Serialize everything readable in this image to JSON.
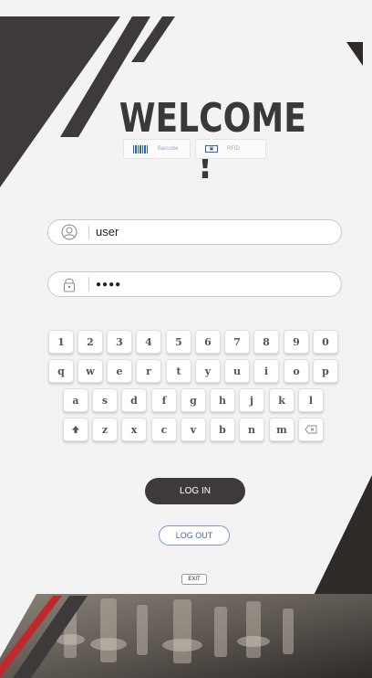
{
  "title": "WELCOME !",
  "modes": {
    "barcode": {
      "label": "Barcode",
      "icon": "barcode-icon"
    },
    "rfid": {
      "label": "RFID",
      "icon": "rfid-card-icon"
    }
  },
  "login": {
    "username_value": "user",
    "password_value": "●●●●",
    "username_icon": "user-icon",
    "password_icon": "lock-icon"
  },
  "keyboard": {
    "row1": [
      "1",
      "2",
      "3",
      "4",
      "5",
      "6",
      "7",
      "8",
      "9",
      "0"
    ],
    "row2": [
      "q",
      "w",
      "e",
      "r",
      "t",
      "y",
      "u",
      "i",
      "o",
      "p"
    ],
    "row3": [
      "a",
      "s",
      "d",
      "f",
      "g",
      "h",
      "j",
      "k",
      "l"
    ],
    "row4": [
      "z",
      "x",
      "c",
      "v",
      "b",
      "n",
      "m"
    ],
    "shift_icon": "shift-up-arrow-icon",
    "backspace_icon": "backspace-icon"
  },
  "buttons": {
    "login": "LOG IN",
    "logout": "LOG OUT",
    "exit": "EXIT"
  },
  "colors": {
    "dark": "#3e3a39",
    "accent_red": "#c0282c",
    "link_blue": "#4a66a8"
  }
}
